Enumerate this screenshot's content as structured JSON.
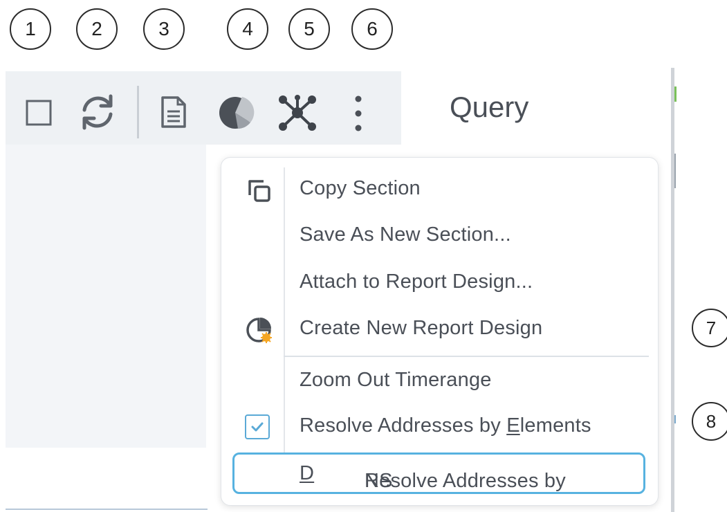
{
  "callouts": [
    "1",
    "2",
    "3",
    "4",
    "5",
    "6",
    "7",
    "8"
  ],
  "toolbar": {
    "icons": [
      "square-icon",
      "refresh-icon",
      "document-icon",
      "pie-chart-icon",
      "network-icon",
      "more-vertical-icon"
    ],
    "title": "Query"
  },
  "menu": {
    "items": [
      {
        "label": "Copy Section",
        "icon": "copy-icon"
      },
      {
        "label": "Save As New Section..."
      },
      {
        "label": "Attach to Report Design..."
      },
      {
        "label": "Create New Report Design",
        "icon": "new-report-icon"
      },
      {
        "label": "Zoom Out Timerange"
      },
      {
        "label_pre": "Resolve Addresses by ",
        "label_mnemonic": "E",
        "label_post": "lements",
        "checked": true
      },
      {
        "label_pre": "Resolve Addresses by ",
        "label_mnemonic": "D",
        "label_post": "NS",
        "highlighted": true
      }
    ]
  },
  "colors": {
    "accent": "#57b2e0",
    "text": "#4a4f57",
    "toolbar_bg": "#eef1f4"
  }
}
